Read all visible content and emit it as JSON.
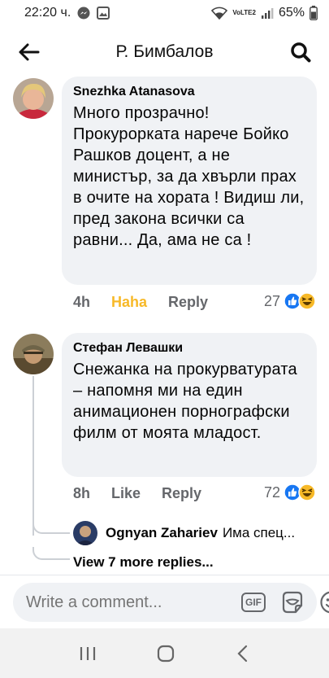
{
  "status_bar": {
    "time": "22:20 ч.",
    "network": "VoLTE2",
    "battery": "65%"
  },
  "header": {
    "title": "Р. Бимбалов"
  },
  "comments": [
    {
      "author": "Snezhka Atanasova",
      "text": "Много прозрачно! Прокурорката нарече Бойко Рашков доцент, а не министър, за да хвърли прах в очите на хората ! Видиш ли, пред закона всички са равни... Да, ама не са !",
      "time": "4h",
      "reaction_label": "Haha",
      "reply_label": "Reply",
      "reaction_count": "27"
    },
    {
      "author": "Стефан Левашки",
      "text": "Снежанка на прокурватурата – напомня ми на един анимационен порнографски филм от моята младост.",
      "time": "8h",
      "reaction_label": "Like",
      "reply_label": "Reply",
      "reaction_count": "72",
      "reply_preview": {
        "author": "Ognyan Zahariev",
        "text": "Има  спец..."
      },
      "view_more": "View 7 more replies..."
    }
  ],
  "composer": {
    "placeholder": "Write a comment..."
  },
  "colors": {
    "bubble": "#f0f2f5",
    "haha": "#f7b928",
    "like": "#1877f2",
    "meta": "#65676b"
  },
  "icons": [
    "back-arrow-icon",
    "search-icon",
    "gif-icon",
    "sticker-icon",
    "emoji-icon",
    "like-reaction-icon",
    "haha-reaction-icon",
    "recents-nav-icon",
    "home-nav-icon",
    "back-nav-icon"
  ]
}
